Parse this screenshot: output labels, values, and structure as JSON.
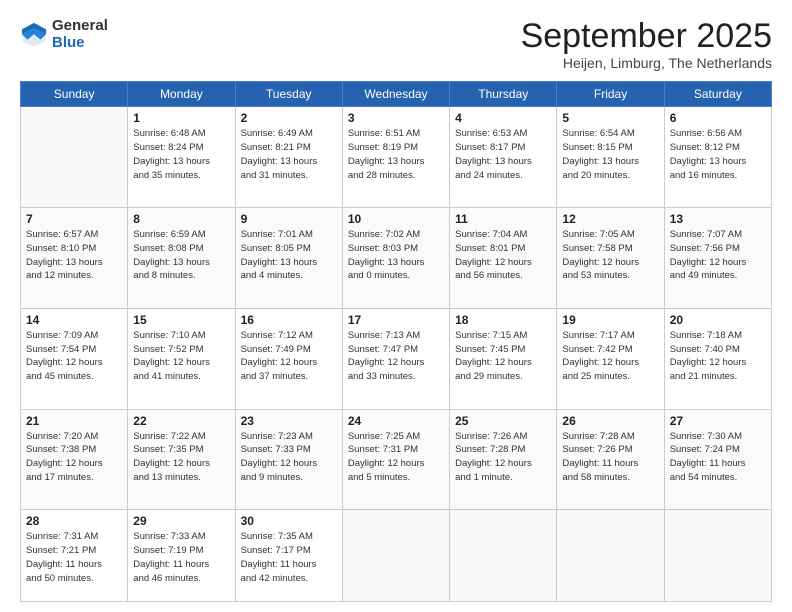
{
  "header": {
    "logo_general": "General",
    "logo_blue": "Blue",
    "month_title": "September 2025",
    "location": "Heijen, Limburg, The Netherlands"
  },
  "weekdays": [
    "Sunday",
    "Monday",
    "Tuesday",
    "Wednesday",
    "Thursday",
    "Friday",
    "Saturday"
  ],
  "weeks": [
    [
      {
        "day": "",
        "info": ""
      },
      {
        "day": "1",
        "info": "Sunrise: 6:48 AM\nSunset: 8:24 PM\nDaylight: 13 hours\nand 35 minutes."
      },
      {
        "day": "2",
        "info": "Sunrise: 6:49 AM\nSunset: 8:21 PM\nDaylight: 13 hours\nand 31 minutes."
      },
      {
        "day": "3",
        "info": "Sunrise: 6:51 AM\nSunset: 8:19 PM\nDaylight: 13 hours\nand 28 minutes."
      },
      {
        "day": "4",
        "info": "Sunrise: 6:53 AM\nSunset: 8:17 PM\nDaylight: 13 hours\nand 24 minutes."
      },
      {
        "day": "5",
        "info": "Sunrise: 6:54 AM\nSunset: 8:15 PM\nDaylight: 13 hours\nand 20 minutes."
      },
      {
        "day": "6",
        "info": "Sunrise: 6:56 AM\nSunset: 8:12 PM\nDaylight: 13 hours\nand 16 minutes."
      }
    ],
    [
      {
        "day": "7",
        "info": "Sunrise: 6:57 AM\nSunset: 8:10 PM\nDaylight: 13 hours\nand 12 minutes."
      },
      {
        "day": "8",
        "info": "Sunrise: 6:59 AM\nSunset: 8:08 PM\nDaylight: 13 hours\nand 8 minutes."
      },
      {
        "day": "9",
        "info": "Sunrise: 7:01 AM\nSunset: 8:05 PM\nDaylight: 13 hours\nand 4 minutes."
      },
      {
        "day": "10",
        "info": "Sunrise: 7:02 AM\nSunset: 8:03 PM\nDaylight: 13 hours\nand 0 minutes."
      },
      {
        "day": "11",
        "info": "Sunrise: 7:04 AM\nSunset: 8:01 PM\nDaylight: 12 hours\nand 56 minutes."
      },
      {
        "day": "12",
        "info": "Sunrise: 7:05 AM\nSunset: 7:58 PM\nDaylight: 12 hours\nand 53 minutes."
      },
      {
        "day": "13",
        "info": "Sunrise: 7:07 AM\nSunset: 7:56 PM\nDaylight: 12 hours\nand 49 minutes."
      }
    ],
    [
      {
        "day": "14",
        "info": "Sunrise: 7:09 AM\nSunset: 7:54 PM\nDaylight: 12 hours\nand 45 minutes."
      },
      {
        "day": "15",
        "info": "Sunrise: 7:10 AM\nSunset: 7:52 PM\nDaylight: 12 hours\nand 41 minutes."
      },
      {
        "day": "16",
        "info": "Sunrise: 7:12 AM\nSunset: 7:49 PM\nDaylight: 12 hours\nand 37 minutes."
      },
      {
        "day": "17",
        "info": "Sunrise: 7:13 AM\nSunset: 7:47 PM\nDaylight: 12 hours\nand 33 minutes."
      },
      {
        "day": "18",
        "info": "Sunrise: 7:15 AM\nSunset: 7:45 PM\nDaylight: 12 hours\nand 29 minutes."
      },
      {
        "day": "19",
        "info": "Sunrise: 7:17 AM\nSunset: 7:42 PM\nDaylight: 12 hours\nand 25 minutes."
      },
      {
        "day": "20",
        "info": "Sunrise: 7:18 AM\nSunset: 7:40 PM\nDaylight: 12 hours\nand 21 minutes."
      }
    ],
    [
      {
        "day": "21",
        "info": "Sunrise: 7:20 AM\nSunset: 7:38 PM\nDaylight: 12 hours\nand 17 minutes."
      },
      {
        "day": "22",
        "info": "Sunrise: 7:22 AM\nSunset: 7:35 PM\nDaylight: 12 hours\nand 13 minutes."
      },
      {
        "day": "23",
        "info": "Sunrise: 7:23 AM\nSunset: 7:33 PM\nDaylight: 12 hours\nand 9 minutes."
      },
      {
        "day": "24",
        "info": "Sunrise: 7:25 AM\nSunset: 7:31 PM\nDaylight: 12 hours\nand 5 minutes."
      },
      {
        "day": "25",
        "info": "Sunrise: 7:26 AM\nSunset: 7:28 PM\nDaylight: 12 hours\nand 1 minute."
      },
      {
        "day": "26",
        "info": "Sunrise: 7:28 AM\nSunset: 7:26 PM\nDaylight: 11 hours\nand 58 minutes."
      },
      {
        "day": "27",
        "info": "Sunrise: 7:30 AM\nSunset: 7:24 PM\nDaylight: 11 hours\nand 54 minutes."
      }
    ],
    [
      {
        "day": "28",
        "info": "Sunrise: 7:31 AM\nSunset: 7:21 PM\nDaylight: 11 hours\nand 50 minutes."
      },
      {
        "day": "29",
        "info": "Sunrise: 7:33 AM\nSunset: 7:19 PM\nDaylight: 11 hours\nand 46 minutes."
      },
      {
        "day": "30",
        "info": "Sunrise: 7:35 AM\nSunset: 7:17 PM\nDaylight: 11 hours\nand 42 minutes."
      },
      {
        "day": "",
        "info": ""
      },
      {
        "day": "",
        "info": ""
      },
      {
        "day": "",
        "info": ""
      },
      {
        "day": "",
        "info": ""
      }
    ]
  ]
}
